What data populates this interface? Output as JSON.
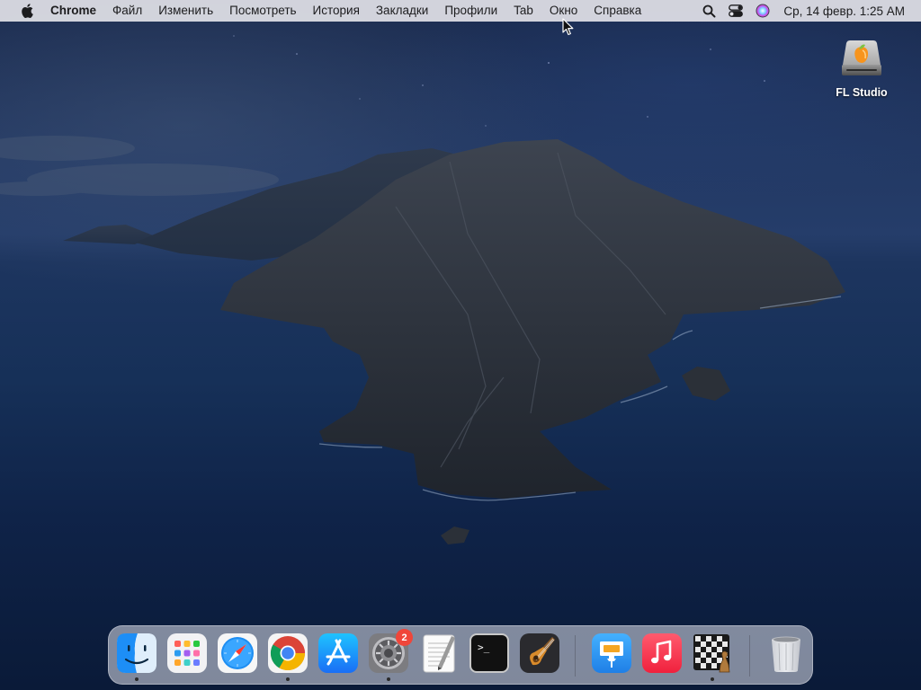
{
  "menubar": {
    "app_name": "Chrome",
    "menus": [
      "Файл",
      "Изменить",
      "Посмотреть",
      "История",
      "Закладки",
      "Профили",
      "Tab",
      "Окно",
      "Справка"
    ],
    "clock": "Ср, 14 февр.  1:25 AM",
    "status_icons": [
      "search-icon",
      "control-center-icon",
      "siri-icon"
    ]
  },
  "desktop": {
    "icons": [
      {
        "label": "FL Studio",
        "icon": "fl-studio-drive-icon"
      }
    ]
  },
  "dock": {
    "apps": [
      {
        "name": "Finder",
        "icon": "finder-icon",
        "running": true
      },
      {
        "name": "Launchpad",
        "icon": "launchpad-icon",
        "running": false
      },
      {
        "name": "Safari",
        "icon": "safari-icon",
        "running": false
      },
      {
        "name": "Google Chrome",
        "icon": "chrome-icon",
        "running": true
      },
      {
        "name": "App Store",
        "icon": "app-store-icon",
        "running": false
      },
      {
        "name": "System Preferences",
        "icon": "system-preferences-icon",
        "running": true,
        "badge": "2"
      },
      {
        "name": "TextEdit",
        "icon": "textedit-icon",
        "running": false
      },
      {
        "name": "Terminal",
        "icon": "terminal-icon",
        "running": false
      },
      {
        "name": "GarageBand",
        "icon": "garageband-icon",
        "running": false
      },
      {
        "name": "Keynote",
        "icon": "keynote-icon",
        "running": false
      },
      {
        "name": "Music",
        "icon": "music-icon",
        "running": false
      },
      {
        "name": "Chess",
        "icon": "chess-icon",
        "running": true
      },
      {
        "name": "Trash",
        "icon": "trash-icon",
        "running": false
      }
    ],
    "terminal_prompt": ">_"
  },
  "colors": {
    "menubar_bg": "#e2e2e8",
    "badge_red": "#f0463a",
    "chrome_red": "#db4437",
    "chrome_yellow": "#f4b400",
    "chrome_green": "#0f9d58",
    "chrome_blue": "#4285f4"
  }
}
